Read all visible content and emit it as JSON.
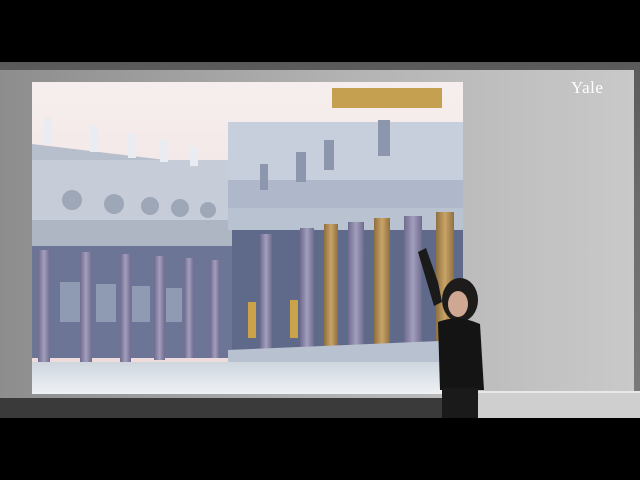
{
  "watermark": {
    "text": "Yale"
  },
  "scene": {
    "description_icons": [
      "slide-image",
      "speaker-figure"
    ],
    "colors": {
      "sky": "#f1e3e3",
      "marble": "#d6dbe6",
      "column_purple": "#8a86a6",
      "column_gold": "#b49058",
      "screen": "#bdbdbd"
    }
  }
}
